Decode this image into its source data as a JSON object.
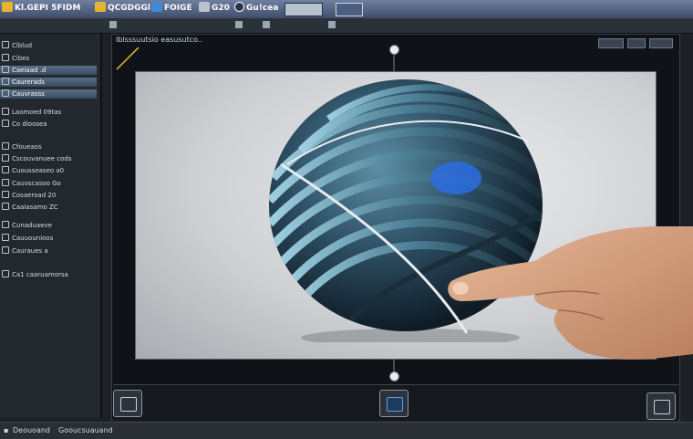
{
  "toolbar": {
    "items": [
      {
        "label": "Kl.GEPI 5FIDM",
        "icon": "folder-icon"
      },
      {
        "label": "QCGDGGl",
        "icon": "camera-icon"
      },
      {
        "label": "FOIGE",
        "icon": "image-icon"
      },
      {
        "label": "G20",
        "icon": "settings-icon"
      },
      {
        "label": "Gu!cea",
        "icon": "target-icon"
      }
    ]
  },
  "view": {
    "title": "Iblsssuutsio easusutco.."
  },
  "left_panel": {
    "items": [
      {
        "label": "Clblud",
        "selected": false
      },
      {
        "label": "Cibes",
        "selected": false
      },
      {
        "label": "Caeiaad .d",
        "selected": true
      },
      {
        "label": "Caurerads",
        "selected": true
      },
      {
        "label": "Cauvrasss",
        "selected": true
      },
      {
        "label": "Laomoed 09tas",
        "selected": false
      },
      {
        "label": "Co dloosea",
        "selected": false
      },
      {
        "label": "Cfoueaos",
        "selected": false
      },
      {
        "label": "Cscouvanuee cods",
        "selected": false
      },
      {
        "label": "Cuousseaseo a0",
        "selected": false
      },
      {
        "label": "Cauoscasoo Go",
        "selected": false
      },
      {
        "label": "Cosaeroad  20",
        "selected": false
      },
      {
        "label": "Caaiasamo  ZC",
        "selected": false
      },
      {
        "label": "Cunaduaeve",
        "selected": false
      },
      {
        "label": "Cauuounioos",
        "selected": false
      },
      {
        "label": "Cauraues a",
        "selected": false
      },
      {
        "label": "Ca1 caaruamorsa",
        "selected": false
      }
    ]
  },
  "status": {
    "text1": "Deouoand",
    "text2": "Gooucsuauand"
  },
  "colors": {
    "sphere_dark": "#1f3647",
    "sphere_light": "#7fb3c9",
    "sphere_accent": "#2b6de0",
    "skin": "#d9a785"
  }
}
